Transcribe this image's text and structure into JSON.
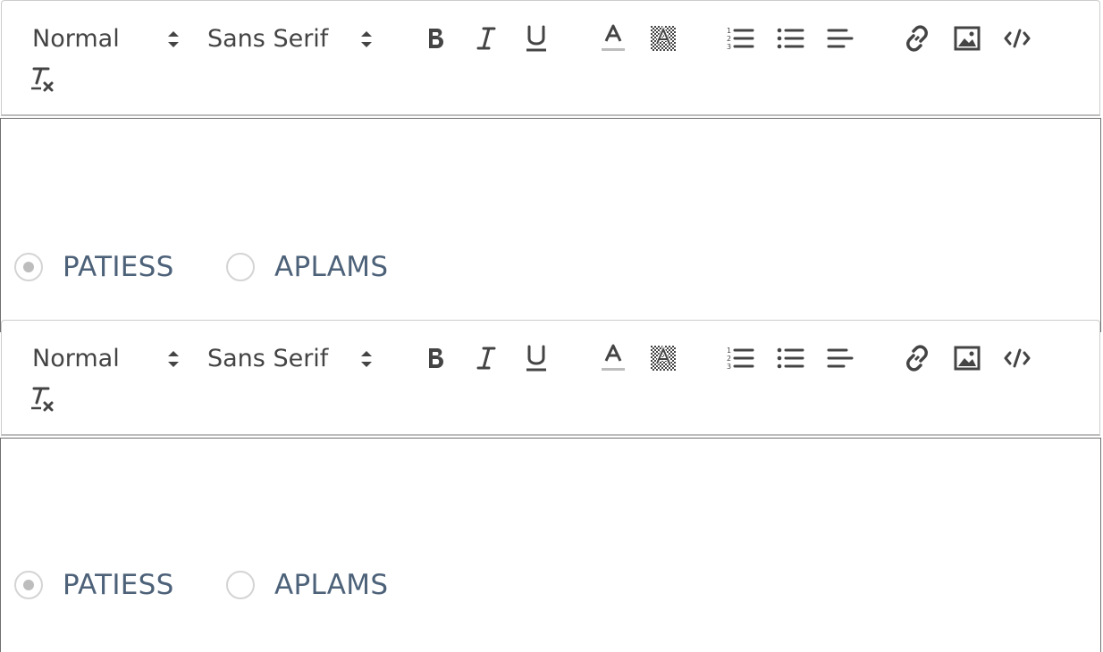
{
  "editors": [
    {
      "toolbar": {
        "header_picker": "Normal",
        "font_picker": "Sans Serif",
        "buttons": [
          "bold-icon",
          "italic-icon",
          "underline-icon",
          "text-color-icon",
          "background-color-icon",
          "ordered-list-icon",
          "bullet-list-icon",
          "align-left-icon",
          "link-icon",
          "image-icon",
          "code-icon",
          "clear-format-icon"
        ]
      },
      "radios": [
        {
          "label": "PATIESS",
          "checked": true
        },
        {
          "label": "APLAMS",
          "checked": false
        }
      ]
    },
    {
      "toolbar": {
        "header_picker": "Normal",
        "font_picker": "Sans Serif",
        "buttons": [
          "bold-icon",
          "italic-icon",
          "underline-icon",
          "text-color-icon",
          "background-color-icon",
          "ordered-list-icon",
          "bullet-list-icon",
          "align-left-icon",
          "link-icon",
          "image-icon",
          "code-icon",
          "clear-format-icon"
        ]
      },
      "radios": [
        {
          "label": "PATIESS",
          "checked": true
        },
        {
          "label": "APLAMS",
          "checked": false
        }
      ]
    }
  ],
  "colors": {
    "icon": "#444444",
    "radio_label": "#4d6279",
    "radio_border": "#d4d4d4"
  }
}
